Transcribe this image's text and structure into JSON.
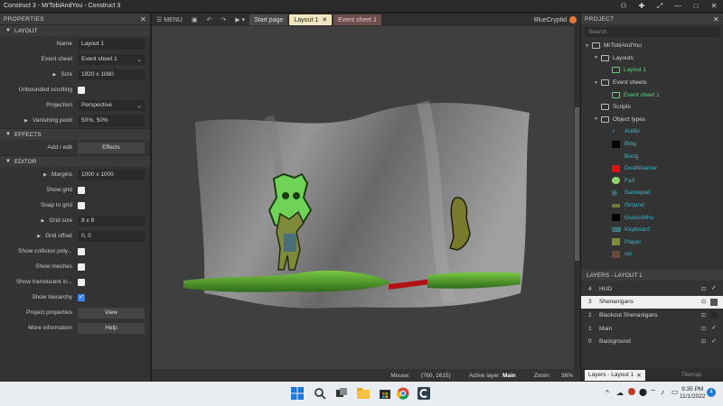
{
  "window": {
    "title": "Construct 3 - MrTobiAndYou - Construct 3"
  },
  "left_panel": {
    "title": "PROPERTIES",
    "sections": {
      "layout": "LAYOUT",
      "effects": "EFFECTS",
      "editor": "EDITOR"
    },
    "layout_props": {
      "name_label": "Name",
      "name_value": "Layout 1",
      "eventsheet_label": "Event sheet",
      "eventsheet_value": "Event sheet 1",
      "size_label": "Size",
      "size_value": "1920 x 1080",
      "unbounded_label": "Unbounded scrolling",
      "projection_label": "Projection",
      "projection_value": "Perspective",
      "vanishing_label": "Vanishing point",
      "vanishing_value": "50%, 50%"
    },
    "effects_props": {
      "addedit_label": "Add / edit",
      "effects_btn": "Effects"
    },
    "editor_props": {
      "margins_label": "Margins",
      "margins_value": "1000 x 1000",
      "showgrid_label": "Show grid",
      "snap_label": "Snap to grid",
      "gridsize_label": "Grid size",
      "gridsize_value": "8 x 8",
      "gridoffset_label": "Grid offset",
      "gridoffset_value": "0, 0",
      "collision_label": "Show collision poly...",
      "meshes_label": "Show meshes",
      "translucent_label": "Show translucent in...",
      "hierarchy_label": "Show hierarchy",
      "projprops_label": "Project properties",
      "view_btn": "View",
      "moreinfo_label": "More information",
      "help_btn": "Help"
    }
  },
  "toolbar": {
    "menu_label": "MENU",
    "tabs": {
      "start": "Start page",
      "layout": "Layout 1",
      "event": "Event sheet 1"
    },
    "user": "BlueCryptid"
  },
  "status": {
    "mouse_label": "Mouse:",
    "mouse_value": "(760, 1615)",
    "layer_label": "Active layer:",
    "layer_value": "Main",
    "zoom_label": "Zoom:",
    "zoom_value": "36%"
  },
  "right_panel": {
    "title": "PROJECT",
    "search_placeholder": "Search",
    "tree": {
      "project": "MrTobiAndYou",
      "layouts": "Layouts",
      "layout1": "Layout 1",
      "eventsheets": "Event sheets",
      "eventsheet1": "Event sheet 1",
      "scripts": "Scripts",
      "objecttypes": "Object types",
      "objects": [
        "Audio",
        "Bing",
        "Boog",
        "Deathbarrier",
        "Fart",
        "Gamepad",
        "Ground",
        "GuessWho",
        "Keyboard",
        "Player",
        "sin"
      ]
    },
    "layers_title": "LAYERS - LAYOUT 1",
    "layers": [
      {
        "num": "4",
        "name": "HUD",
        "visible": "✓"
      },
      {
        "num": "3",
        "name": "Shenanigans",
        "visible": ""
      },
      {
        "num": "2",
        "name": "Blackout Shenanigans",
        "visible": ""
      },
      {
        "num": "1",
        "name": "Main",
        "visible": "✓"
      },
      {
        "num": "0",
        "name": "Background",
        "visible": "✓"
      }
    ],
    "tabs": {
      "layers": "Layers - Layout 1",
      "tilemap": "Tilemap"
    }
  },
  "taskbar": {
    "time": "9:35 PM",
    "date": "11/1/2022"
  },
  "colors": {
    "accent_green": "#5fd37a",
    "accent_teal": "#3cb6c8",
    "layout_tab": "#f0e6c0"
  }
}
